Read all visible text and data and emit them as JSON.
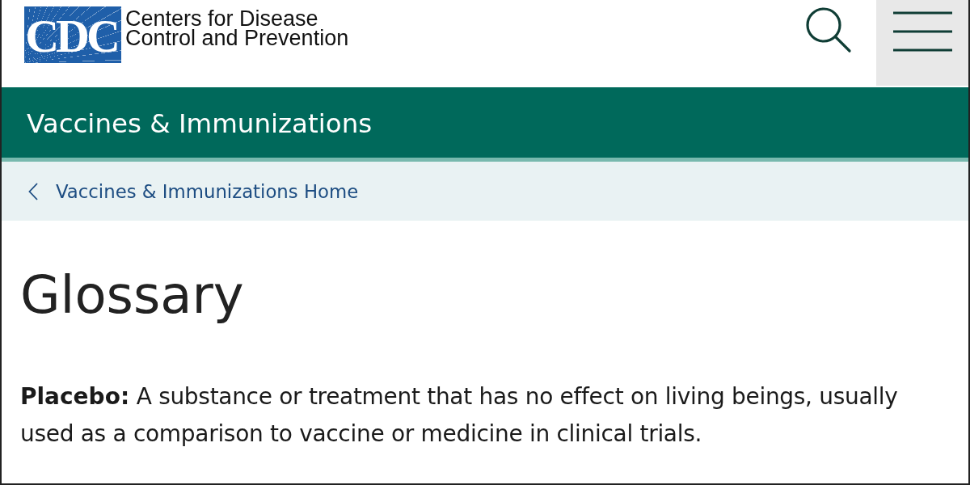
{
  "header": {
    "logo_mark": "CDC",
    "agency_name": [
      "Centers for Disease",
      "Control and Prevention"
    ]
  },
  "section_bar": {
    "title": "Vaccines & Immunizations"
  },
  "breadcrumb": {
    "back_link": "Vaccines & Immunizations Home"
  },
  "page": {
    "title": "Glossary",
    "definition": "**Placebo:** A substance or treatment that has no effect on living beings, usually used as a comparison to vaccine or medicine in clinical trials."
  }
}
